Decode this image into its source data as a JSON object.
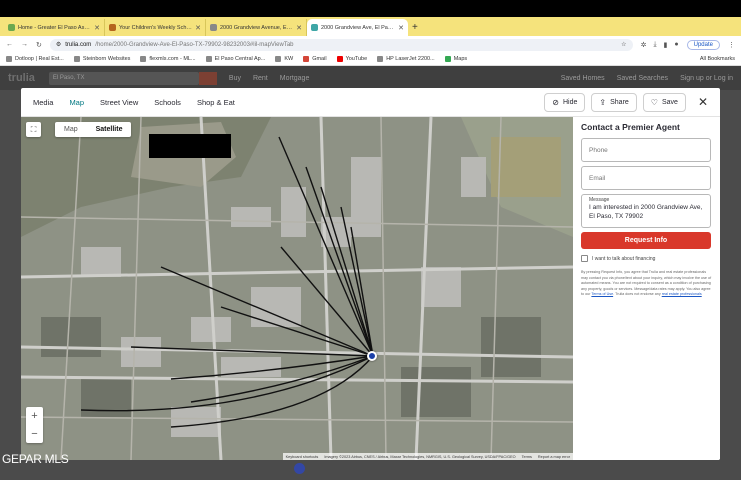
{
  "browser": {
    "tabs": [
      {
        "title": "Home - Greater El Paso Asso...",
        "active": false
      },
      {
        "title": "Your Children's Weekly Scho...",
        "active": false
      },
      {
        "title": "2000 Grandview Avenue, El P...",
        "active": false
      },
      {
        "title": "2000 Grandview Ave, El Paso...",
        "active": true
      }
    ],
    "address": {
      "host": "trulia.com",
      "path": "/home/2000-Grandview-Ave-El-Paso-TX-79902-98232003#lil-mapViewTab"
    },
    "update_label": "Update",
    "bookmarks": [
      "Dotloop | Real Est...",
      "Steinborn Websites",
      "flexmls.com - ML...",
      "El Paso Central Ap...",
      "KW",
      "Gmail",
      "YouTube",
      "HP LaserJet 2200...",
      "Maps"
    ],
    "all_bookmarks": "All Bookmarks"
  },
  "trulia_header": {
    "logo": "trulia",
    "search_value": "El Paso, TX",
    "links": [
      "Buy",
      "Rent",
      "Mortgage"
    ],
    "right_links": [
      "Saved Homes",
      "Saved Searches",
      "Sign up or Log in"
    ]
  },
  "modal": {
    "tabs": [
      "Media",
      "Map",
      "Street View",
      "Schools",
      "Shop & Eat"
    ],
    "active_tab": "Map",
    "hide_label": "Hide",
    "share_label": "Share",
    "save_label": "Save"
  },
  "map": {
    "toggle": [
      "Map",
      "Satellite"
    ],
    "active_toggle": "Satellite",
    "zoom_in": "+",
    "zoom_out": "−",
    "attribution": [
      "Keyboard shortcuts",
      "Imagery ©2023 Airbus, CNES / Airbus, Maxar Technologies, NMRGIS, U.S. Geological Survey, USDA/FPAC/GEO",
      "Terms",
      "Report a map error"
    ]
  },
  "contact": {
    "title": "Contact a Premier Agent",
    "phone_placeholder": "Phone",
    "email_placeholder": "Email",
    "message_label": "Message",
    "message_value": "I am interested in 2000 Grandview Ave, El Paso, TX 79902",
    "request_label": "Request Info",
    "financing_label": "I want to talk about financing",
    "disclaimer": "By pressing Request Info, you agree that Trulia and real estate professionals may contact you via phone/text about your inquiry, which may involve the use of automated means. You are not required to consent as a condition of purchasing any property, goods or services. Message/data rates may apply. You also agree to our",
    "terms_link": "Terms of Use",
    "disclaimer_tail": "Trulia does not endorse any",
    "pro_link": "real estate professionals"
  },
  "watermark": "GEPAR MLS",
  "colors": {
    "tabbar": "#f5e37c",
    "accent_teal": "#007882",
    "request_red": "#d9382b",
    "pin_blue": "#1b3fa8"
  }
}
